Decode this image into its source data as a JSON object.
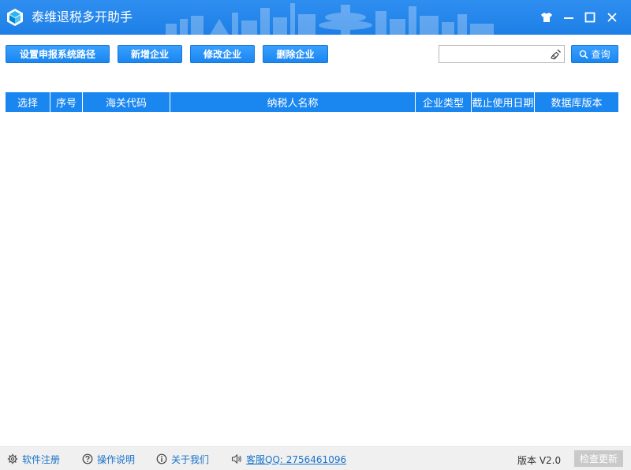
{
  "window": {
    "title": "泰维退税多开助手",
    "icons": [
      "cube-logo-icon",
      "shirt-skin-icon",
      "minimize-icon",
      "maximize-icon",
      "close-icon"
    ]
  },
  "toolbar": {
    "set_path_label": "设置申报系统路径",
    "add_label": "新增企业",
    "edit_label": "修改企业",
    "delete_label": "删除企业"
  },
  "search": {
    "value": "",
    "button_label": "查询",
    "icons": [
      "broom-clear-icon",
      "magnifier-icon"
    ]
  },
  "grid": {
    "columns": [
      "选择",
      "序号",
      "海关代码",
      "纳税人名称",
      "企业类型",
      "截止使用日期",
      "数据库版本"
    ],
    "rows": []
  },
  "status": {
    "register_label": "软件注册",
    "help_label": "操作说明",
    "about_label": "关于我们",
    "qq_label": "客服QQ: 2756461096",
    "version_label": "版本 V2.0",
    "update_label": "检查更新"
  },
  "colors": {
    "titlebar": "#1d7fe6",
    "button": "#1a86f0",
    "link": "#1a73c8",
    "disabled": "#c9c9c9"
  }
}
